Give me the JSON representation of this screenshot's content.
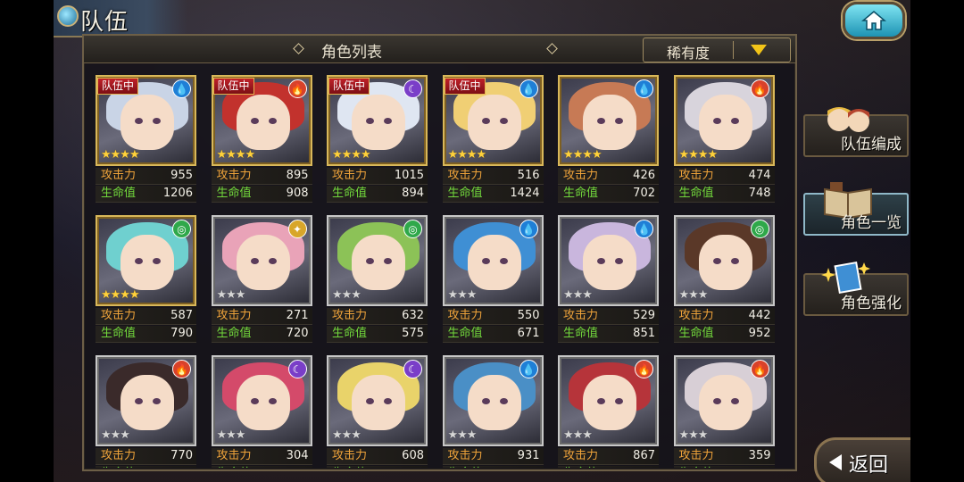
{
  "page_title": "队伍",
  "panel_title": "角色列表",
  "sort": {
    "label": "稀有度"
  },
  "side_menu": [
    {
      "label": "队伍编成"
    },
    {
      "label": "角色一览"
    },
    {
      "label": "角色强化"
    }
  ],
  "back_label": "返回",
  "stat_labels": {
    "attack": "攻击力",
    "hp": "生命值"
  },
  "colors": {
    "water": "#1f7fd6",
    "fire": "#d8422a",
    "dark": "#7a3ec8",
    "wind": "#2fa84a",
    "light": "#d8a62a"
  },
  "cards": [
    {
      "badge": "队伍中",
      "element": "water",
      "element_icon": "water-drop-icon",
      "stars": 4,
      "rarity": "gold",
      "attack": "955",
      "hp": "1206",
      "hair": "#c9d4e6"
    },
    {
      "badge": "队伍中",
      "element": "fire",
      "element_icon": "flame-icon",
      "stars": 4,
      "rarity": "gold",
      "attack": "895",
      "hp": "908",
      "hair": "#c2322d"
    },
    {
      "badge": "队伍中",
      "element": "dark",
      "element_icon": "moon-icon",
      "stars": 4,
      "rarity": "gold",
      "attack": "1015",
      "hp": "894",
      "hair": "#dfe6f2"
    },
    {
      "badge": "队伍中",
      "element": "water",
      "element_icon": "water-drop-icon",
      "stars": 4,
      "rarity": "gold",
      "attack": "516",
      "hp": "1424",
      "hair": "#f0cf74"
    },
    {
      "badge": "",
      "element": "water",
      "element_icon": "water-drop-icon",
      "stars": 4,
      "rarity": "gold",
      "attack": "426",
      "hp": "702",
      "hair": "#c77a55"
    },
    {
      "badge": "",
      "element": "fire",
      "element_icon": "flame-icon",
      "stars": 4,
      "rarity": "gold",
      "attack": "474",
      "hp": "748",
      "hair": "#d8d4dc"
    },
    {
      "badge": "",
      "element": "wind",
      "element_icon": "swirl-icon",
      "stars": 4,
      "rarity": "gold",
      "attack": "587",
      "hp": "790",
      "hair": "#6fd0cf"
    },
    {
      "badge": "",
      "element": "light",
      "element_icon": "sun-icon",
      "stars": 3,
      "rarity": "silver",
      "attack": "271",
      "hp": "720",
      "hair": "#e9a3b8"
    },
    {
      "badge": "",
      "element": "wind",
      "element_icon": "swirl-icon",
      "stars": 3,
      "rarity": "silver",
      "attack": "632",
      "hp": "575",
      "hair": "#8cc257"
    },
    {
      "badge": "",
      "element": "water",
      "element_icon": "water-drop-icon",
      "stars": 3,
      "rarity": "silver",
      "attack": "550",
      "hp": "671",
      "hair": "#3f8fd4"
    },
    {
      "badge": "",
      "element": "water",
      "element_icon": "water-drop-icon",
      "stars": 3,
      "rarity": "silver",
      "attack": "529",
      "hp": "851",
      "hair": "#c9b6dd"
    },
    {
      "badge": "",
      "element": "wind",
      "element_icon": "swirl-icon",
      "stars": 3,
      "rarity": "silver",
      "attack": "442",
      "hp": "952",
      "hair": "#5a3828"
    },
    {
      "badge": "",
      "element": "fire",
      "element_icon": "flame-icon",
      "stars": 3,
      "rarity": "silver",
      "attack": "770",
      "hp": "",
      "hair": "#3a2a2a"
    },
    {
      "badge": "",
      "element": "dark",
      "element_icon": "moon-icon",
      "stars": 3,
      "rarity": "silver",
      "attack": "304",
      "hp": "",
      "hair": "#d44a6a"
    },
    {
      "badge": "",
      "element": "dark",
      "element_icon": "moon-icon",
      "stars": 3,
      "rarity": "silver",
      "attack": "608",
      "hp": "",
      "hair": "#e9d36a"
    },
    {
      "badge": "",
      "element": "water",
      "element_icon": "water-drop-icon",
      "stars": 3,
      "rarity": "silver",
      "attack": "931",
      "hp": "",
      "hair": "#4a8fc6"
    },
    {
      "badge": "",
      "element": "fire",
      "element_icon": "flame-icon",
      "stars": 3,
      "rarity": "silver",
      "attack": "867",
      "hp": "",
      "hair": "#b6343a"
    },
    {
      "badge": "",
      "element": "fire",
      "element_icon": "flame-icon",
      "stars": 3,
      "rarity": "silver",
      "attack": "359",
      "hp": "",
      "hair": "#d8cfd6"
    }
  ]
}
